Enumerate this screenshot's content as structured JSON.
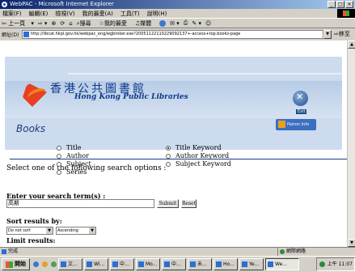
{
  "window": {
    "title": "WebPAC - Microsoft Internet Explorer",
    "controls": [
      "_",
      "□",
      "×"
    ]
  },
  "menu": [
    "檔案(F)",
    "編輯(E)",
    "檢視(V)",
    "我的最愛(A)",
    "工具(T)",
    "說明(H)"
  ],
  "toolbar": {
    "back": "上一頁",
    "search": "搜尋",
    "favorites": "我的最愛",
    "media": "媒體"
  },
  "address": {
    "label": "網址(D)",
    "url": "http://libcat.hkpl.gov.hk/webpac_eng/wgbroker.exe?20051122110229092137+-access+top.books-page",
    "go": "移至"
  },
  "page": {
    "library_chinese": "香港公共圖書館",
    "library_english": "Hong Kong Public Libraries",
    "exit_label": "Exit",
    "section": "Books",
    "patron_label": "Patron Info",
    "prompt": "Select one of the following search options :",
    "options_left": [
      "Title",
      "Author",
      "Subject",
      "Series"
    ],
    "options_right": [
      "Title Keyword",
      "Author Keyword",
      "Subject Keyword"
    ],
    "selected_option": "Title Keyword",
    "enter_label": "Enter your search term(s) :",
    "search_term": "高斯",
    "submit_label": "Submit",
    "reset_label": "Reset",
    "sort_label": "Sort results by:",
    "sort_value": "Do not sort",
    "order_value": "Ascending",
    "limit_label": "Limit results:"
  },
  "status": {
    "text": "完成",
    "zone": "網際網路"
  },
  "taskbar": {
    "start": "開始",
    "tasks": [
      "文...",
      "Wi...",
      "中...",
      "Mo...",
      "中...",
      "未...",
      "Ho...",
      "Ye...",
      "We..."
    ],
    "active_task": "We...",
    "clock": "上午 11:07"
  }
}
